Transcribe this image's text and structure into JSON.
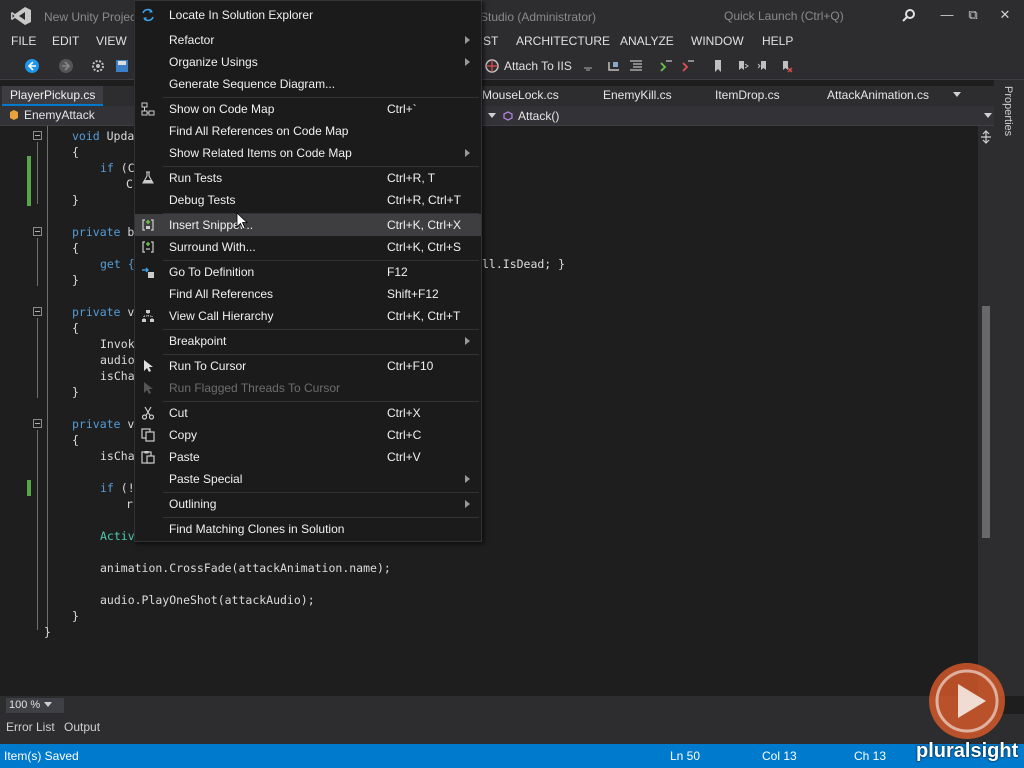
{
  "titlebar": {
    "project_name": "New Unity Projec",
    "app_suffix": "Studio (Administrator)",
    "quick_launch_placeholder": "Quick Launch (Ctrl+Q)"
  },
  "menubar": {
    "file": "FILE",
    "edit": "EDIT",
    "view": "VIEW",
    "test_tail": "ST",
    "architecture": "ARCHITECTURE",
    "analyze": "ANALYZE",
    "window": "WINDOW",
    "help": "HELP"
  },
  "toolbar": {
    "attach_label": "Attach To IIS"
  },
  "tabs": [
    {
      "label": "PlayerPickup.cs",
      "active": true
    },
    {
      "label": "MouseLock.cs",
      "active": false
    },
    {
      "label": "EnemyKill.cs",
      "active": false
    },
    {
      "label": "ItemDrop.cs",
      "active": false
    },
    {
      "label": "AttackAnimation.cs",
      "active": false
    }
  ],
  "navbar": {
    "class_name": "EnemyAttack",
    "method_name": "Attack()"
  },
  "code": {
    "l1_kw": "void",
    "l1_rest": " Upda",
    "l2": "{",
    "l3_kw": "if",
    "l3_rest": " (C",
    "l4": "C",
    "l5": "}",
    "l6_kw": "private",
    "l6_rest": " b",
    "l7": "{",
    "l8_a": "get {",
    "l8_b": "ll.IsDead; }",
    "l9": "}",
    "l10_kw": "private",
    "l10_rest": " v",
    "l11": "{",
    "l12": "Invok",
    "l13": "audio",
    "l14": "isCha",
    "l15": "}",
    "l16_kw": "private",
    "l16_rest": " v",
    "l17": "{",
    "l18": "isCha",
    "l19_kw": "if",
    "l19_rest": " (!",
    "l20": "r",
    "l21": "Activ",
    "l22": "animation.CrossFade(attackAnimation.name);",
    "l23": "audio.PlayOneShot(attackAudio);",
    "l24": "}",
    "l25": "}"
  },
  "context_menu": {
    "items": [
      {
        "label": "Locate In Solution Explorer",
        "shortcut": "",
        "icon": "locate-icon"
      },
      {
        "label": "Refactor",
        "shortcut": "",
        "submenu": true
      },
      {
        "label": "Organize Usings",
        "shortcut": "",
        "submenu": true
      },
      {
        "label": "Generate Sequence Diagram...",
        "shortcut": ""
      },
      {
        "label": "Show on Code Map",
        "shortcut": "Ctrl+`",
        "icon": "code-map-icon"
      },
      {
        "label": "Find All References on Code Map",
        "shortcut": ""
      },
      {
        "label": "Show Related Items on Code Map",
        "shortcut": "",
        "submenu": true
      },
      {
        "label": "Run Tests",
        "shortcut": "Ctrl+R, T",
        "icon": "run-tests-icon"
      },
      {
        "label": "Debug Tests",
        "shortcut": "Ctrl+R, Ctrl+T"
      },
      {
        "label": "Insert Snippet...",
        "shortcut": "Ctrl+K, Ctrl+X",
        "icon": "insert-snippet-icon",
        "highlighted": true
      },
      {
        "label": "Surround With...",
        "shortcut": "Ctrl+K, Ctrl+S",
        "icon": "surround-with-icon"
      },
      {
        "label": "Go To Definition",
        "shortcut": "F12",
        "icon": "go-to-definition-icon"
      },
      {
        "label": "Find All References",
        "shortcut": "Shift+F12"
      },
      {
        "label": "View Call Hierarchy",
        "shortcut": "Ctrl+K, Ctrl+T",
        "icon": "call-hierarchy-icon"
      },
      {
        "label": "Breakpoint",
        "shortcut": "",
        "submenu": true
      },
      {
        "label": "Run To Cursor",
        "shortcut": "Ctrl+F10",
        "icon": "run-to-cursor-icon"
      },
      {
        "label": "Run Flagged Threads To Cursor",
        "shortcut": "",
        "disabled": true,
        "icon": "run-flagged-icon"
      },
      {
        "label": "Cut",
        "shortcut": "Ctrl+X",
        "icon": "cut-icon"
      },
      {
        "label": "Copy",
        "shortcut": "Ctrl+C",
        "icon": "copy-icon"
      },
      {
        "label": "Paste",
        "shortcut": "Ctrl+V",
        "icon": "paste-icon"
      },
      {
        "label": "Paste Special",
        "shortcut": "",
        "submenu": true
      },
      {
        "label": "Outlining",
        "shortcut": "",
        "submenu": true
      },
      {
        "label": "Find Matching Clones in Solution",
        "shortcut": ""
      }
    ]
  },
  "properties_label": "Properties",
  "zoom": "100 %",
  "bottom_tabs": {
    "error_list": "Error List",
    "output": "Output"
  },
  "statusbar": {
    "message": "Item(s) Saved",
    "line": "Ln 50",
    "col": "Col 13",
    "ch": "Ch 13"
  },
  "watermark": {
    "brand": "pluralsight"
  },
  "colors": {
    "accent": "#007acc",
    "keyword": "#569cd6",
    "brand_orange": "#e85f2a"
  }
}
